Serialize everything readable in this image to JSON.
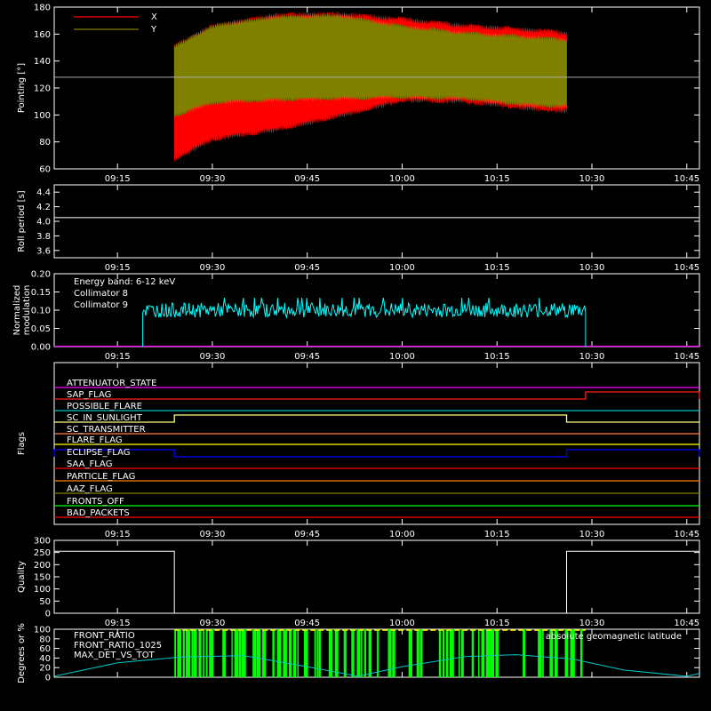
{
  "chart_data": [
    {
      "type": "line",
      "ylabel": "Pointing [°]",
      "ylim": [
        60,
        180
      ],
      "yticks": [
        "60",
        "80",
        "100",
        "120",
        "140",
        "160",
        "180"
      ],
      "xticks": [
        "09:15",
        "09:30",
        "09:45",
        "10:00",
        "10:15",
        "10:30",
        "10:45"
      ],
      "legend": [
        "X",
        "Y"
      ],
      "colors": {
        "X": "#ff0000",
        "Y": "#808000",
        "reference": "#aaaaaa"
      },
      "reference_line": 128,
      "x_range": [
        "09:05",
        "10:47"
      ],
      "data_range": [
        "09:24",
        "10:26"
      ],
      "series": [
        {
          "name": "X",
          "upper_envelope": {
            "x": [
              "09:24",
              "09:30",
              "09:40",
              "09:50",
              "10:00",
              "10:10",
              "10:20",
              "10:26"
            ],
            "y": [
              150,
              165,
              173,
              174,
              170,
              165,
              162,
              160
            ]
          },
          "lower_envelope": {
            "x": [
              "09:24",
              "09:30",
              "09:40",
              "09:50",
              "10:00",
              "10:10",
              "10:20",
              "10:26"
            ],
            "y": [
              68,
              83,
              90,
              100,
              112,
              111,
              106,
              104
            ]
          }
        },
        {
          "name": "Y",
          "upper_envelope": {
            "x": [
              "09:24",
              "09:30",
              "09:40",
              "09:50",
              "10:00",
              "10:10",
              "10:20",
              "10:26"
            ],
            "y": [
              150,
              165,
              172,
              173,
              165,
              160,
              157,
              155
            ]
          },
          "lower_envelope": {
            "x": [
              "09:24",
              "09:30",
              "09:40",
              "09:50",
              "10:00",
              "10:10",
              "10:20",
              "10:26"
            ],
            "y": [
              100,
              110,
              112,
              113,
              114,
              113,
              108,
              107
            ]
          }
        }
      ]
    },
    {
      "type": "line",
      "ylabel": "Roll period [s]",
      "ylim": [
        3.5,
        4.5
      ],
      "yticks": [
        "3.6",
        "3.8",
        "4.0",
        "4.2",
        "4.4"
      ],
      "xticks": [
        "09:15",
        "09:30",
        "09:45",
        "10:00",
        "10:15",
        "10:30",
        "10:45"
      ],
      "series": [
        {
          "values": [
            4.05
          ]
        }
      ]
    },
    {
      "type": "line",
      "ylabel": "Normalized modulation",
      "ylim": [
        0,
        0.2
      ],
      "yticks": [
        "0.00",
        "0.05",
        "0.10",
        "0.15",
        "0.20"
      ],
      "xticks": [
        "09:15",
        "09:30",
        "09:45",
        "10:00",
        "10:15",
        "10:30",
        "10:45"
      ],
      "annotation": "Energy band: 6-12 keV",
      "legend": [
        "Collimator 8",
        "Collimator 9"
      ],
      "colors": {
        "Collimator 8": "#00ffff",
        "Collimator 9": "#ff00ff"
      },
      "series": [
        {
          "name": "Collimator 8",
          "x_range": [
            "09:19",
            "10:29"
          ],
          "mean": 0.1,
          "spread": 0.02,
          "peak": 0.135
        },
        {
          "name": "Collimator 9",
          "values": [
            0.0
          ]
        }
      ]
    },
    {
      "type": "line",
      "ylabel": "Flags",
      "xticks": [
        "09:15",
        "09:30",
        "09:45",
        "10:00",
        "10:15",
        "10:30",
        "10:45"
      ],
      "flags": [
        {
          "name": "ATTENUATOR_STATE",
          "color": "#ff00ff",
          "steps": []
        },
        {
          "name": "SAP_FLAG",
          "color": "#ff2020",
          "steps": [
            [
              "10:29",
              "10:47"
            ]
          ]
        },
        {
          "name": "POSSIBLE_FLARE",
          "color": "#00c0c0",
          "steps": []
        },
        {
          "name": "SC_IN_SUNLIGHT",
          "color": "#ffff80",
          "steps": [
            [
              "09:24",
              "10:26"
            ]
          ]
        },
        {
          "name": "SC_TRANSMITTER",
          "color": "#ff8040",
          "steps": []
        },
        {
          "name": "FLARE_FLAG",
          "color": "#ffff00",
          "steps": []
        },
        {
          "name": "ECLIPSE_FLAG",
          "color": "#0000ff",
          "steps": [
            [
              "09:05",
              "09:24"
            ],
            [
              "10:26",
              "10:47"
            ]
          ]
        },
        {
          "name": "SAA_FLAG",
          "color": "#ff0000",
          "steps": []
        },
        {
          "name": "PARTICLE_FLAG",
          "color": "#ff8000",
          "steps": []
        },
        {
          "name": "AAZ_FLAG",
          "color": "#808000",
          "steps": []
        },
        {
          "name": "FRONTS_OFF",
          "color": "#00ff00",
          "steps": []
        },
        {
          "name": "BAD_PACKETS",
          "color": "#ff0000",
          "steps": []
        }
      ]
    },
    {
      "type": "line",
      "ylabel": "Quality",
      "ylim": [
        0,
        300
      ],
      "yticks": [
        "0",
        "50",
        "100",
        "150",
        "200",
        "250",
        "300"
      ],
      "xticks": [
        "09:15",
        "09:30",
        "09:45",
        "10:00",
        "10:15",
        "10:30",
        "10:45"
      ],
      "series": [
        {
          "x": [
            "09:05",
            "09:24",
            "09:24",
            "10:26",
            "10:26",
            "10:47"
          ],
          "values": [
            255,
            255,
            0,
            0,
            255,
            255
          ]
        }
      ]
    },
    {
      "type": "line",
      "ylabel": "Degrees or %",
      "ylim": [
        0,
        100
      ],
      "yticks": [
        "0",
        "20",
        "40",
        "60",
        "80",
        "100"
      ],
      "legend": [
        "FRONT_RATIO",
        "FRONT_RATIO_1025",
        "MAX_DET_VS_TOT"
      ],
      "annotation": "absolute geomagnetic latitude",
      "colors": {
        "FRONT_RATIO": "#ffff00",
        "FRONT_RATIO_1025": "#00ff00",
        "MAX_DET_VS_TOT": "#ff8000",
        "latitude": "#00c8c8"
      },
      "series": [
        {
          "name": "absolute geomagnetic latitude",
          "x": [
            "09:05",
            "09:15",
            "09:25",
            "09:35",
            "09:45",
            "09:53",
            "10:00",
            "10:10",
            "10:18",
            "10:27",
            "10:35",
            "10:45",
            "10:47"
          ],
          "values": [
            2,
            30,
            42,
            45,
            22,
            2,
            22,
            43,
            47,
            38,
            15,
            2,
            8
          ]
        },
        {
          "name": "FRONT_RATIO_1025",
          "x_range": [
            "09:24",
            "10:29"
          ],
          "values": [
            100
          ]
        }
      ]
    }
  ]
}
